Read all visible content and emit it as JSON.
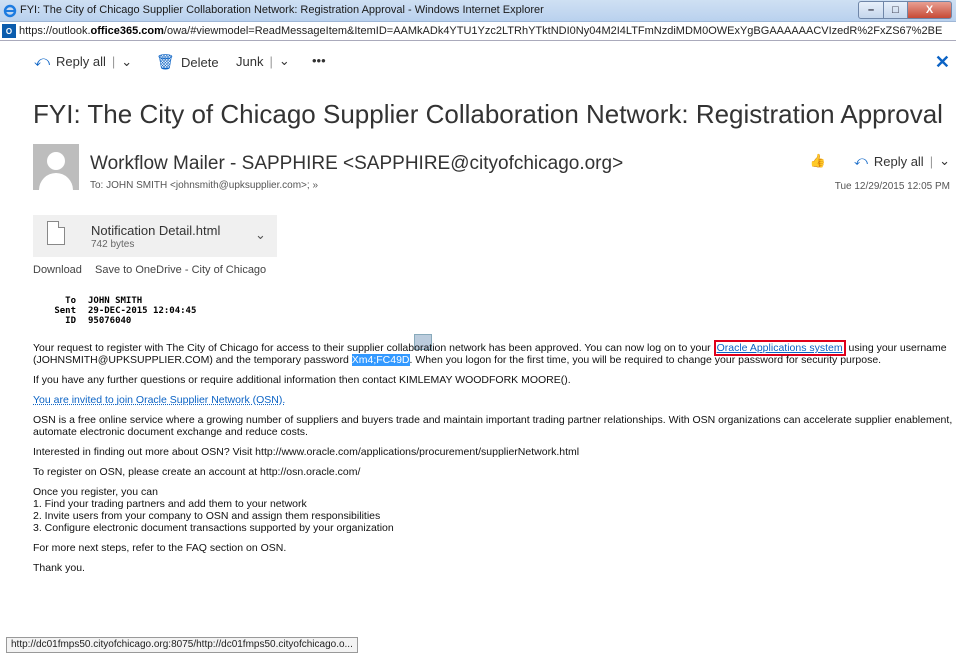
{
  "window": {
    "title": "FYI: The City of Chicago Supplier Collaboration Network: Registration Approval - Windows Internet Explorer",
    "url_prefix": "https://outlook.",
    "url_domain": "office365.com",
    "url_rest": "/owa/#viewmodel=ReadMessageItem&ItemID=AAMkADk4YTU1Yzc2LTRhYTktNDI0Ny04M2I4LTFmNzdiMDM0OWExYgBGAAAAAACVIzedR%2FxZS67%2BE",
    "minimize": "–",
    "maximize": "□",
    "close": "X"
  },
  "toolbar": {
    "reply_all": "Reply all",
    "delete": "Delete",
    "junk": "Junk",
    "more": "•••"
  },
  "message": {
    "subject": "FYI: The City of Chicago Supplier Collaboration Network: Registration Approval",
    "sender": "Workflow Mailer - SAPPHIRE <SAPPHIRE@cityofchicago.org>",
    "to": "To: JOHN SMITH <johnsmith@upksupplier.com>; ",
    "to_more": "»",
    "reply_all": "Reply all",
    "date": "Tue 12/29/2015 12:05 PM"
  },
  "attachment": {
    "name": "Notification Detail.html",
    "size": "742 bytes",
    "download": "Download",
    "save": "Save to OneDrive - City of Chicago"
  },
  "header_fields": {
    "to_k": "To",
    "to_v": "JOHN SMITH",
    "sent_k": "Sent",
    "sent_v": "29-DEC-2015 12:04:45",
    "id_k": "ID",
    "id_v": "95076040"
  },
  "body": {
    "p1a": "Your request to register with The City of Chicago for access to their supplier collaboration network has been approved. You can now log on to your ",
    "p1_link": "Oracle Applications system",
    "p1b": " using your username (JOHNSMITH@UPKSUPPLIER.COM) and the temporary password ",
    "p1_pw": "Xm4;FC49D",
    "p1c": ". When you logon for the first time, you will be required to change your password for security purpose.",
    "p2": "If you have any further questions or require additional information then contact KIMLEMAY WOODFORK MOORE().",
    "p3": "You are invited to join Oracle Supplier Network (OSN).",
    "p4": "OSN is a free online service where a growing number of suppliers and buyers trade and maintain important trading partner relationships. With OSN organizations can accelerate supplier enablement, automate electronic document exchange and reduce costs.",
    "p5": "Interested in finding out more about OSN? Visit http://www.oracle.com/applications/procurement/supplierNetwork.html",
    "p6": "To register on OSN, please create an account at http://osn.oracle.com/",
    "p7a": "Once you register, you can",
    "p7b": "1. Find your trading partners and add them to your network",
    "p7c": "2. Invite users from your company to OSN and assign them responsibilities",
    "p7d": "3. Configure electronic document transactions supported by your organization",
    "p8": "For more next steps, refer to the FAQ section on OSN.",
    "p9": "Thank you."
  },
  "status_url": "http://dc01fmps50.cityofchicago.org:8075/http://dc01fmps50.cityofchicago.o..."
}
